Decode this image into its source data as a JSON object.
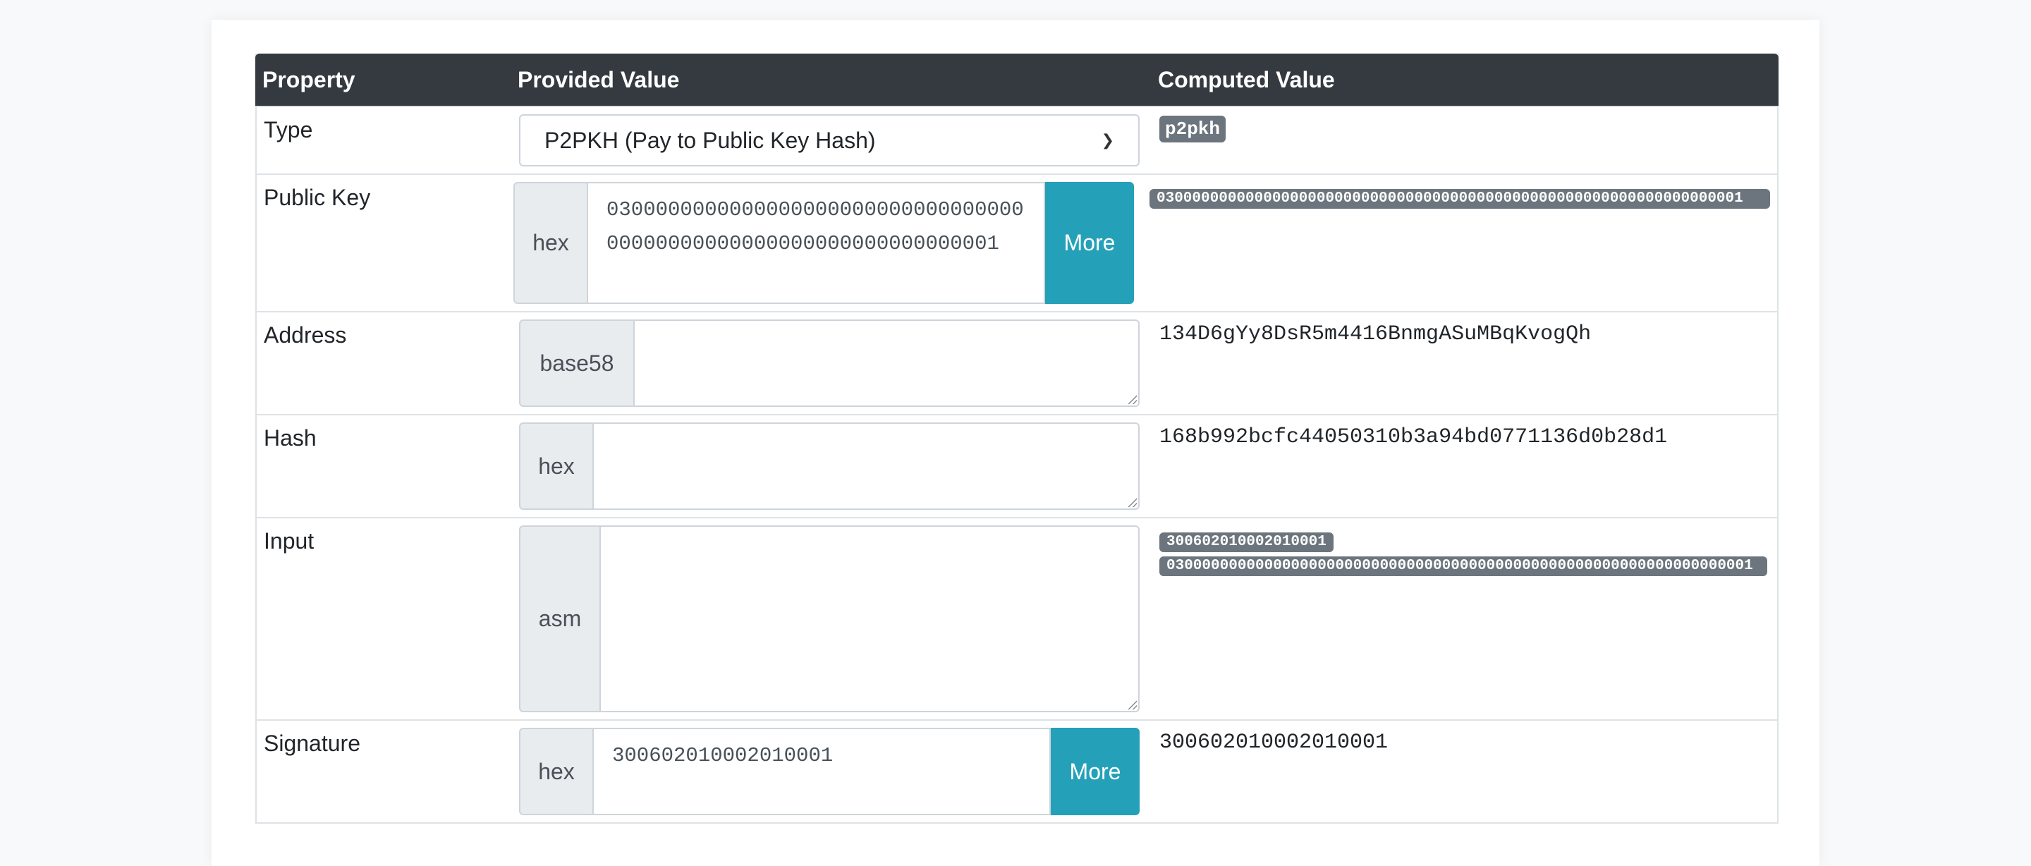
{
  "table": {
    "headers": {
      "property": "Property",
      "provided": "Provided Value",
      "computed": "Computed Value"
    },
    "rows": {
      "type": {
        "label": "Type",
        "select_value": "P2PKH (Pay to Public Key Hash)",
        "computed_badge": "p2pkh"
      },
      "public_key": {
        "label": "Public Key",
        "prefix": "hex",
        "value": "030000000000000000000000000000000000000000000000000000000000000001",
        "more_label": "More",
        "computed_badge": "030000000000000000000000000000000000000000000000000000000000000001"
      },
      "address": {
        "label": "Address",
        "prefix": "base58",
        "value": "",
        "computed": "134D6gYy8DsR5m4416BnmgASuMBqKvogQh"
      },
      "hash": {
        "label": "Hash",
        "prefix": "hex",
        "value": "",
        "computed": "168b992bcfc44050310b3a94bd0771136d0b28d1"
      },
      "input": {
        "label": "Input",
        "prefix": "asm",
        "value": "",
        "computed_badges": [
          "300602010002010001",
          "030000000000000000000000000000000000000000000000000000000000000001"
        ]
      },
      "signature": {
        "label": "Signature",
        "prefix": "hex",
        "value": "300602010002010001",
        "more_label": "More",
        "computed": "300602010002010001"
      }
    }
  }
}
